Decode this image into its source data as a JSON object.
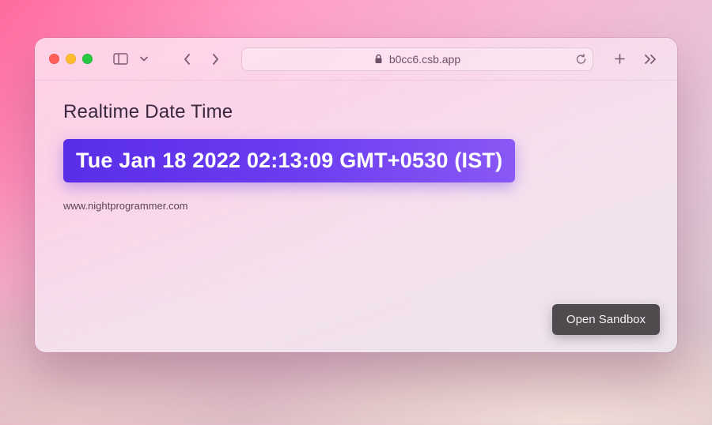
{
  "browser": {
    "url_display": "b0cc6.csb.app"
  },
  "page": {
    "heading": "Realtime Date Time",
    "datetime": "Tue Jan 18 2022 02:13:09 GMT+0530 (IST)",
    "credit": "www.nightprogrammer.com",
    "sandbox_button": "Open Sandbox"
  },
  "colors": {
    "accent_start": "#5a2ee8",
    "accent_end": "#8a58f5",
    "button_bg": "#4e4a4e"
  }
}
